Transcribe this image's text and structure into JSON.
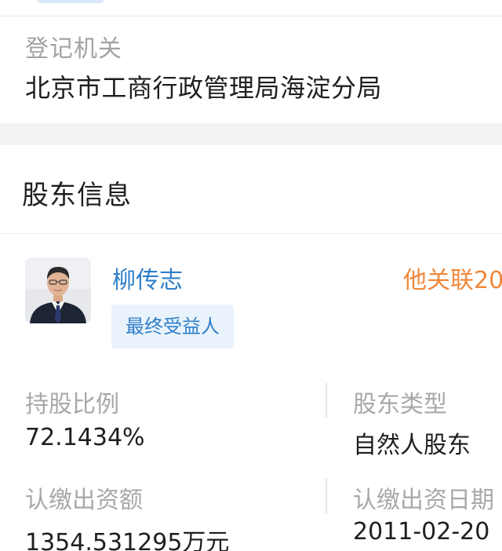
{
  "registration": {
    "label": "登记机关",
    "value": "北京市工商行政管理局海淀分局"
  },
  "shareholder_section": {
    "title": "股东信息"
  },
  "shareholder": {
    "name": "柳传志",
    "related_link": "他关联20",
    "badge": "最终受益人",
    "fields": {
      "share_ratio_label": "持股比例",
      "share_ratio_value": "72.1434%",
      "type_label": "股东类型",
      "type_value": "自然人股东",
      "subscribed_capital_label": "认缴出资额",
      "subscribed_capital_value": "1354.531295万元",
      "subscribed_date_label": "认缴出资日期",
      "subscribed_date_value": "2011-02-20"
    }
  },
  "colors": {
    "link_blue": "#2f7fc8",
    "accent_orange": "#f0883a",
    "label_gray": "#a8a8a8",
    "section_gap": "#f2f3f5",
    "badge_bg": "#eaf3fc"
  }
}
